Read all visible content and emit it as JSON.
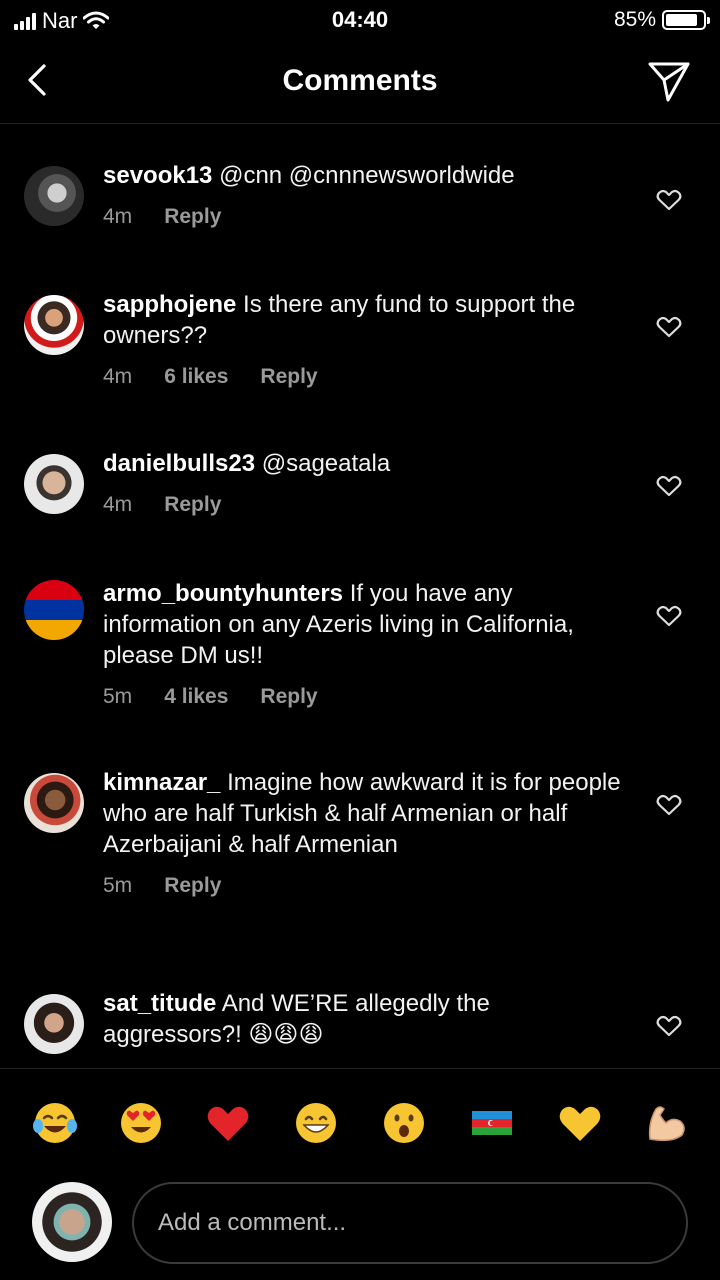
{
  "status_bar": {
    "carrier": "Nar",
    "time": "04:40",
    "battery": "85%",
    "battery_level": 0.85
  },
  "header": {
    "title": "Comments",
    "back_icon": "chevron-left-icon",
    "send_icon": "paper-plane-icon"
  },
  "comments": [
    {
      "username": "sevook13",
      "text": " @cnn @cnnnewsworldwide",
      "time": "4m",
      "likes": "",
      "reply": "Reply"
    },
    {
      "username": "sapphojene",
      "text": " Is there any fund to support the owners??",
      "time": "4m",
      "likes": "6 likes",
      "reply": "Reply"
    },
    {
      "username": "danielbulls23",
      "text": " @sageatala",
      "time": "4m",
      "likes": "",
      "reply": "Reply"
    },
    {
      "username": "armo_bountyhunters",
      "text": " If you have any information on any Azeris living in California, please DM us!!",
      "time": "5m",
      "likes": "4 likes",
      "reply": "Reply"
    },
    {
      "username": "kimnazar_",
      "text": " Imagine how awkward it is for people who are half Turkish & half Armenian or half Azerbaijani & half Armenian",
      "time": "5m",
      "likes": "",
      "reply": "Reply"
    },
    {
      "username": "sat_titude",
      "text": " And WE’RE allegedly the aggressors?! 😩😩😩",
      "time": "",
      "likes": "",
      "reply": ""
    }
  ],
  "emoji_bar": [
    "face-with-tears-of-joy",
    "heart-eyes",
    "red-heart",
    "grinning-face",
    "surprised-face",
    "azerbaijan-flag",
    "yellow-heart",
    "flexed-biceps"
  ],
  "input": {
    "placeholder": "Add a comment..."
  },
  "colors": {
    "background": "#000000",
    "meta_text": "#9a9a9a",
    "input_border": "#3a3a3a"
  }
}
